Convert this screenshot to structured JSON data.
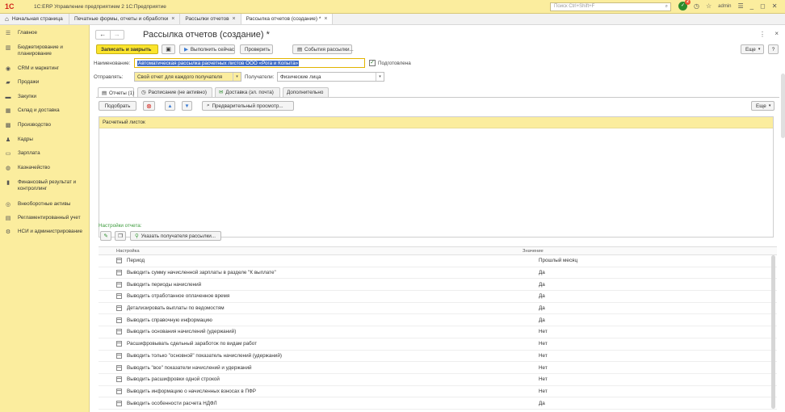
{
  "titlebar": {
    "logo": "1С",
    "app_title": "1С:ERP Управление предприятием 2 1С:Предприятие",
    "search_placeholder": "Поиск Ctrl+Shift+F",
    "notif_count": "2",
    "user": "admin"
  },
  "tabs": {
    "home": "Начальная страница",
    "t1": "Печатные формы, отчеты и обработки",
    "t2": "Рассылки отчетов",
    "t3": "Рассылка отчетов (создание) *"
  },
  "sidebar": [
    {
      "label": "Главное",
      "icon": "menu-icon"
    },
    {
      "label": "Бюджетирование и планирование",
      "icon": "chart-icon"
    },
    {
      "label": "CRM и маркетинг",
      "icon": "crm-icon"
    },
    {
      "label": "Продажи",
      "icon": "bag-icon"
    },
    {
      "label": "Закупки",
      "icon": "truck-icon"
    },
    {
      "label": "Склад и доставка",
      "icon": "warehouse-icon"
    },
    {
      "label": "Производство",
      "icon": "factory-icon"
    },
    {
      "label": "Кадры",
      "icon": "person-icon"
    },
    {
      "label": "Зарплата",
      "icon": "money-icon"
    },
    {
      "label": "Казначейство",
      "icon": "treasury-icon"
    },
    {
      "label": "Финансовый результат и контроллинг",
      "icon": "finance-icon"
    },
    {
      "label": "Внеоборотные активы",
      "icon": "assets-icon"
    },
    {
      "label": "Регламентированный учет",
      "icon": "book-icon"
    },
    {
      "label": "НСИ и администрирование",
      "icon": "gear-icon"
    }
  ],
  "form": {
    "title": "Рассылка отчетов (создание) *",
    "save_close": "Записать и закрыть",
    "run_now": "Выполнить сейчас",
    "check": "Проверить",
    "events": "События рассылки...",
    "more": "Еще",
    "help": "?",
    "name_label": "Наименование:",
    "name_value": "Автоматическая рассылка расчетных листов ООО «Рога и Копыта»",
    "prepared_label": "Подготовлена",
    "send_label": "Отправлять:",
    "send_value": "Свой отчет для каждого получателя",
    "recipients_label": "Получатели:",
    "recipients_value": "Физические лица"
  },
  "form_tabs": {
    "reports": "Отчеты (1)",
    "schedule": "Расписание (не активно)",
    "delivery": "Доставка (эл. почта)",
    "extra": "Дополнительно"
  },
  "reports_toolbar": {
    "pick": "Подобрать",
    "preview": "Предварительный просмотр...",
    "more": "Еще"
  },
  "reports_list": [
    "Расчетный листок"
  ],
  "report_settings": {
    "label": "Настройки отчета:",
    "specify_recipients": "Указать получателя рассылки..."
  },
  "settings_table": {
    "col_name": "Настройка",
    "col_value": "Значение",
    "rows": [
      {
        "name": "Период",
        "value": "Прошлый месяц"
      },
      {
        "name": "Выводить сумму начисленной зарплаты в разделе \"К выплате\"",
        "value": "Да"
      },
      {
        "name": "Выводить периоды начислений",
        "value": "Да"
      },
      {
        "name": "Выводить отработанное оплаченное время",
        "value": "Да"
      },
      {
        "name": "Детализировать выплаты по ведомостям",
        "value": "Да"
      },
      {
        "name": "Выводить справочную информацию",
        "value": "Да"
      },
      {
        "name": "Выводить основания начислений (удержаний)",
        "value": "Нет"
      },
      {
        "name": "Расшифровывать сдельный заработок по видам работ",
        "value": "Нет"
      },
      {
        "name": "Выводить только \"основной\" показатель начислений (удержаний)",
        "value": "Нет"
      },
      {
        "name": "Выводить \"все\" показатели начислений и удержаний",
        "value": "Нет"
      },
      {
        "name": "Выводить расшифровки одной строкой",
        "value": "Нет"
      },
      {
        "name": "Выводить информацию о начисленных взносах в ПФР",
        "value": "Нет"
      },
      {
        "name": "Выводить особенности расчета НДФЛ",
        "value": "Да"
      }
    ]
  }
}
